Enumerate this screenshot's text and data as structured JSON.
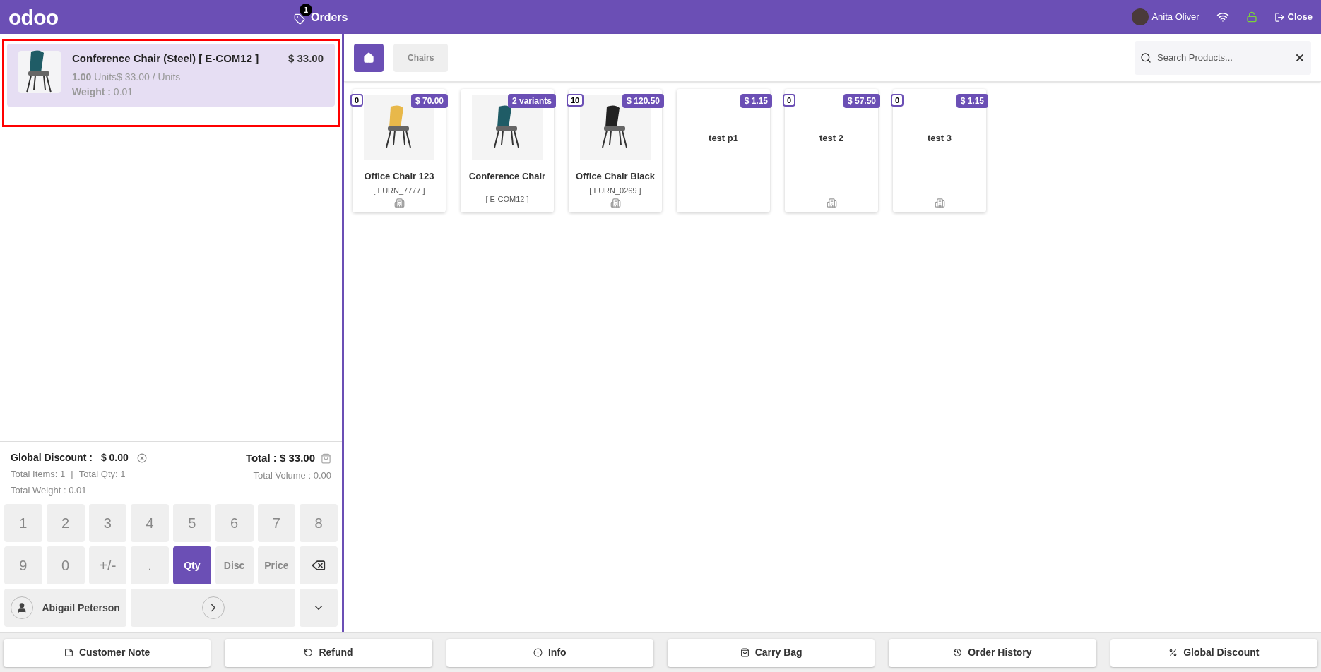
{
  "header": {
    "logo": "odoo",
    "orders_badge": "1",
    "orders_label": "Orders",
    "user": "Anita Oliver",
    "close_label": "Close"
  },
  "order_lines": [
    {
      "name": "Conference Chair (Steel) [ E-COM12 ]",
      "price": "$ 33.00",
      "qty": "1.00",
      "unit_info": "Units$ 33.00 / Units",
      "weight_label": "Weight :",
      "weight": "0.01",
      "selected": true,
      "highlighted": true
    }
  ],
  "summary": {
    "discount_label": "Global Discount :",
    "discount": "$ 0.00",
    "items": "Total Items: 1",
    "separator": "|",
    "qty": "Total Qty: 1",
    "weight": "Total Weight : 0.01",
    "total": "Total : $ 33.00",
    "volume": "Total Volume : 0.00"
  },
  "numpad": [
    {
      "kind": "key",
      "label": "1"
    },
    {
      "kind": "key",
      "label": "2"
    },
    {
      "kind": "key",
      "label": "3"
    },
    {
      "kind": "key",
      "label": "4"
    },
    {
      "kind": "key",
      "label": "5"
    },
    {
      "kind": "key",
      "label": "6"
    },
    {
      "kind": "key",
      "label": "7"
    },
    {
      "kind": "key",
      "label": "8"
    },
    {
      "kind": "key",
      "label": "9"
    },
    {
      "kind": "key",
      "label": "0"
    },
    {
      "kind": "key",
      "label": "+/-"
    },
    {
      "kind": "key",
      "label": "."
    },
    {
      "kind": "mode",
      "label": "Qty",
      "selected": true
    },
    {
      "kind": "mode",
      "label": "Disc",
      "selected": false
    },
    {
      "kind": "mode",
      "label": "Price",
      "selected": false
    },
    {
      "kind": "backspace"
    }
  ],
  "customer": "Abigail Peterson",
  "breadcrumbs": [
    {
      "label": "Chairs"
    }
  ],
  "search": {
    "placeholder": "Search Products..."
  },
  "products": [
    {
      "name": "Office Chair 123",
      "ref": "[ FURN_7777 ]",
      "price": "$ 70.00",
      "stock": "0",
      "kind": "photo",
      "info_icon": true
    },
    {
      "name": "Conference Chair",
      "ref": "[ E-COM12 ]",
      "price": "2 variants",
      "kind": "photo",
      "info_icon": false
    },
    {
      "name": "Office Chair Black",
      "ref": "[ FURN_0269 ]",
      "price": "$ 120.50",
      "stock": "10",
      "kind": "photo",
      "info_icon": true
    },
    {
      "name": "test p1",
      "price": "$ 1.15",
      "kind": "text",
      "info_icon": false
    },
    {
      "name": "test 2",
      "price": "$ 57.50",
      "stock": "0",
      "kind": "text",
      "info_icon": true
    },
    {
      "name": "test 3",
      "price": "$ 1.15",
      "stock": "0",
      "kind": "text",
      "info_icon": true
    }
  ],
  "actions": [
    {
      "kind": "note",
      "label": "Customer Note"
    },
    {
      "kind": "refund",
      "label": "Refund"
    },
    {
      "kind": "info",
      "label": "Info"
    },
    {
      "kind": "bag",
      "label": "Carry Bag"
    },
    {
      "kind": "history",
      "label": "Order History"
    },
    {
      "kind": "percent",
      "label": "Global Discount"
    }
  ]
}
